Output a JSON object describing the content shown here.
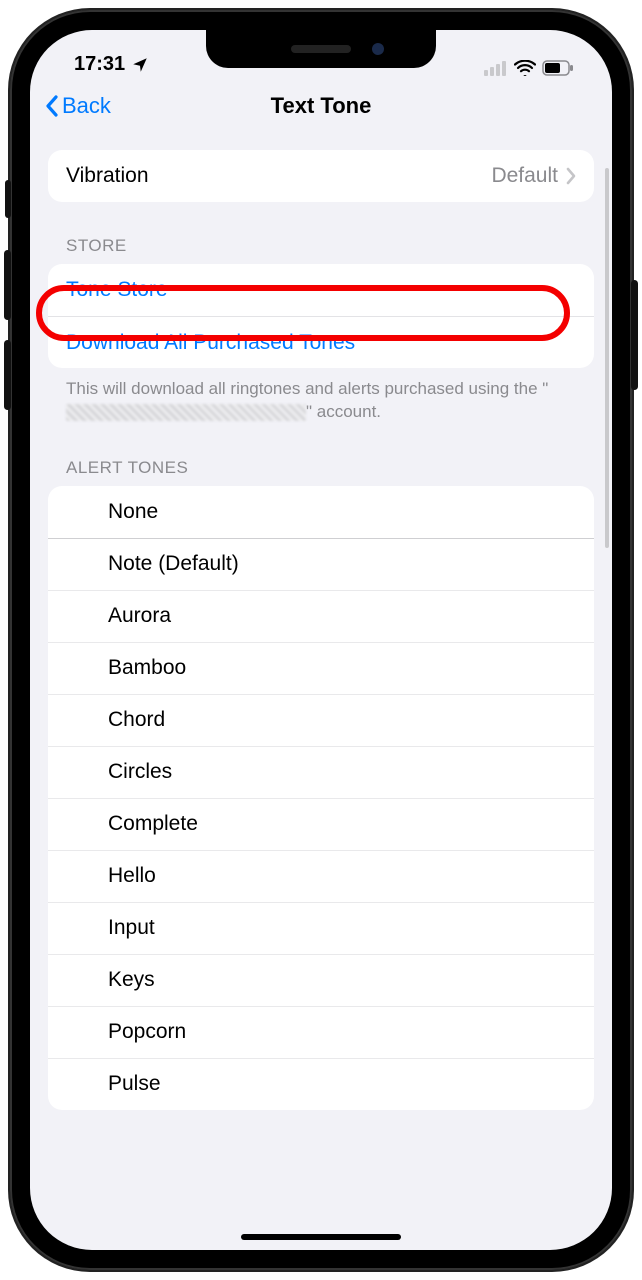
{
  "status": {
    "time": "17:31"
  },
  "nav": {
    "back": "Back",
    "title": "Text Tone"
  },
  "vibration": {
    "label": "Vibration",
    "value": "Default"
  },
  "store": {
    "header": "STORE",
    "tone_store": "Tone Store",
    "download_all": "Download All Purchased Tones",
    "footer_prefix": "This will download all ringtones and alerts purchased using the \"",
    "footer_suffix": "\" account."
  },
  "alert": {
    "header": "ALERT TONES",
    "items": [
      "None",
      "Note (Default)",
      "Aurora",
      "Bamboo",
      "Chord",
      "Circles",
      "Complete",
      "Hello",
      "Input",
      "Keys",
      "Popcorn",
      "Pulse"
    ]
  }
}
